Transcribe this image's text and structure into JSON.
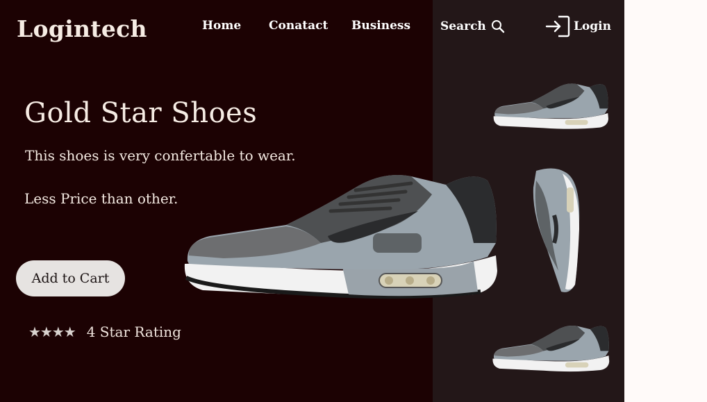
{
  "header": {
    "logo": "Logintech",
    "nav": [
      "Home",
      "Conatact",
      "Business"
    ],
    "search_label": "Search",
    "login_label": "Login"
  },
  "hero": {
    "title": "Gold Star Shoes",
    "line1": "This shoes is very confertable to wear.",
    "line2": "Less Price than other.",
    "cart_label": "Add to Cart",
    "stars": "★★★★",
    "rating_text": "4 Star Rating",
    "rating_value": 4
  },
  "colors": {
    "left_bg": "#1c0203",
    "right_bg": "#231718",
    "page_bg": "#fffaf9",
    "button_bg": "#e6e3e1"
  },
  "icons": [
    "search-icon",
    "login-icon",
    "star-icon"
  ]
}
